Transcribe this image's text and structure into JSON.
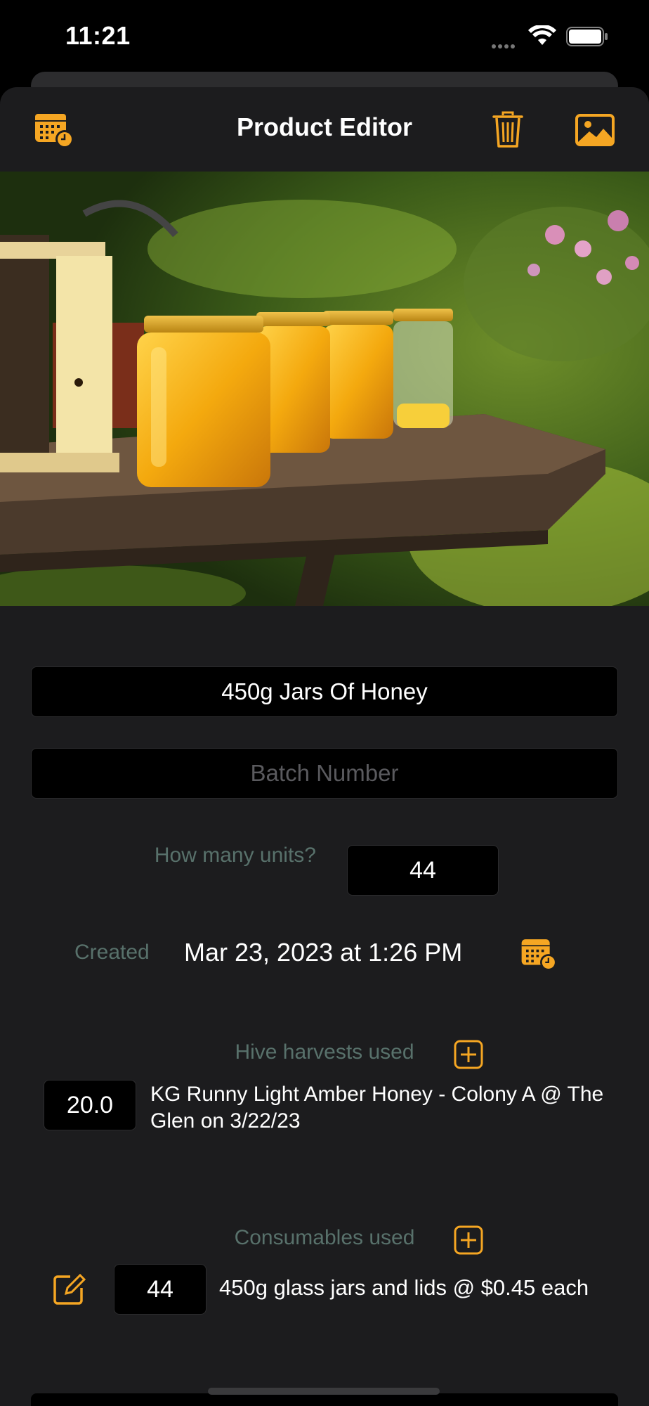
{
  "status_bar": {
    "time": "11:21"
  },
  "nav": {
    "title": "Product Editor"
  },
  "product": {
    "name": "450g Jars Of Honey",
    "batch_placeholder": "Batch Number",
    "units_label": "How many units?",
    "units_value": "44",
    "created_label": "Created",
    "created_value": "Mar 23, 2023 at 1:26 PM"
  },
  "harvests": {
    "label": "Hive harvests used",
    "items": [
      {
        "amount": "20.0",
        "description": "KG Runny Light Amber Honey - Colony A @ The Glen on 3/22/23"
      }
    ]
  },
  "consumables": {
    "label": "Consumables used",
    "items": [
      {
        "amount": "44",
        "description": "450g glass jars and lids @ $0.45 each"
      }
    ]
  },
  "colors": {
    "accent": "#f5a623",
    "label": "#58716b",
    "sheet": "#1c1c1e",
    "field": "#000000"
  }
}
